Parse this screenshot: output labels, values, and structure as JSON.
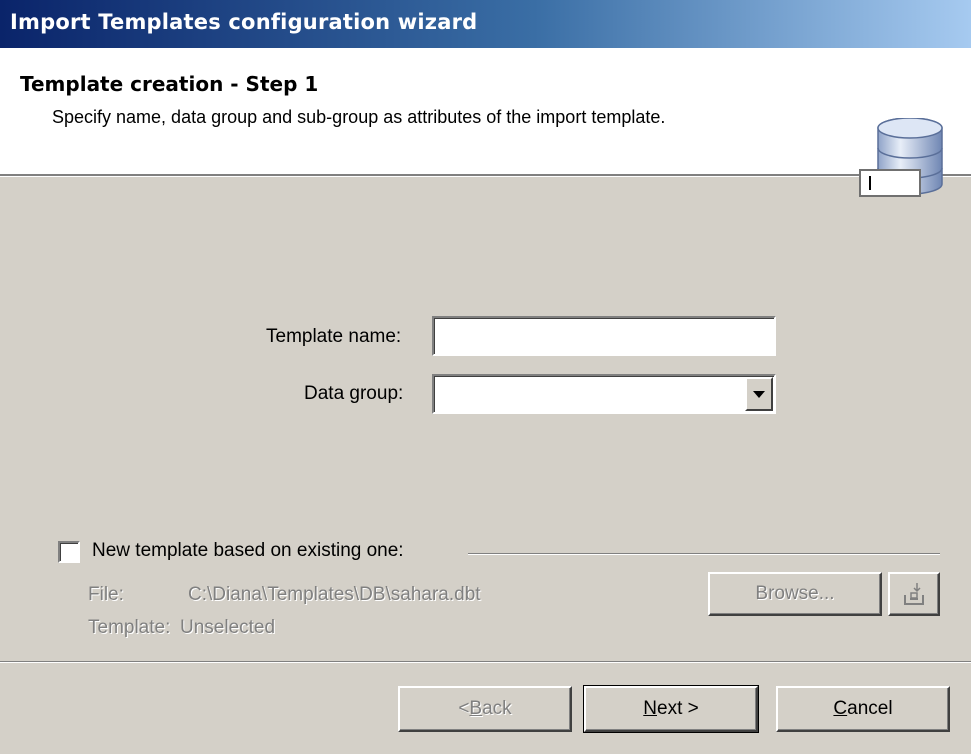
{
  "window": {
    "title": "Import Templates configuration wizard"
  },
  "header": {
    "title": "Template creation - Step 1",
    "description": "Specify name, data group and sub-group as attributes of the import template.",
    "icon": "database-icon"
  },
  "form": {
    "template_name_label": "Template name:",
    "template_name_value": "",
    "data_group_label": "Data group:",
    "data_group_value": ""
  },
  "existing": {
    "checkbox_label": "New template based on existing one:",
    "checked": false,
    "file_label": "File:",
    "file_value": "C:\\Diana\\Templates\\DB\\sahara.dbt",
    "template_label": "Template:",
    "template_value": "Unselected",
    "browse_label": "Browse...",
    "import_icon": "import-icon"
  },
  "buttons": {
    "back": {
      "prefix": "< ",
      "accel": "B",
      "rest": "ack"
    },
    "next": {
      "accel": "N",
      "rest": "ext >"
    },
    "cancel": {
      "accel": "C",
      "rest": "ancel"
    }
  }
}
